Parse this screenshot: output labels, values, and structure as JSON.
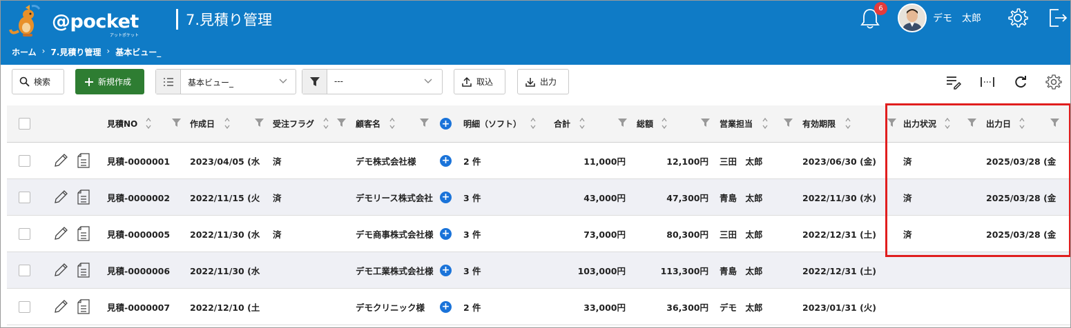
{
  "app": {
    "logo_text": "@pocket",
    "logo_sub": "アットポケット",
    "page_title": "7.見積り管理",
    "breadcrumb": [
      "ホーム",
      "7.見積り管理",
      "基本ビュー_"
    ],
    "notification_count": "6",
    "user_name": "デモ　太郎"
  },
  "toolbar": {
    "search_label": "検索",
    "new_label": "新規作成",
    "view_value": "基本ビュー_",
    "filter_value": "---",
    "import_label": "取込",
    "export_label": "出力"
  },
  "table": {
    "columns": [
      "見積NO",
      "作成日",
      "受注フラグ",
      "顧客名",
      "明細（ソフト）",
      "合計",
      "総額",
      "営業担当",
      "有効期限",
      "出力状況",
      "出力日"
    ],
    "rows": [
      {
        "no": "見積-0000001",
        "created": "2023/04/05 (水",
        "flag": "済",
        "customer": "デモ株式会社様",
        "detail": "2 件",
        "subtotal": "11,000円",
        "total": "12,100円",
        "sales": "三田　太郎",
        "expiry": "2023/06/30 (金)",
        "output_status": "済",
        "output_date": "2025/03/28 (金"
      },
      {
        "no": "見積-0000002",
        "created": "2022/11/15 (火",
        "flag": "済",
        "customer": "デモリース株式会社",
        "detail": "3 件",
        "subtotal": "43,000円",
        "total": "47,300円",
        "sales": "青島　太郎",
        "expiry": "2022/11/30 (水)",
        "output_status": "済",
        "output_date": "2025/03/28 (金"
      },
      {
        "no": "見積-0000005",
        "created": "2022/11/30 (水",
        "flag": "済",
        "customer": "デモ商事株式会社様",
        "detail": "3 件",
        "subtotal": "73,000円",
        "total": "80,300円",
        "sales": "三田　太郎",
        "expiry": "2022/12/31 (土)",
        "output_status": "済",
        "output_date": "2025/03/28 (金"
      },
      {
        "no": "見積-0000006",
        "created": "2022/11/30 (水",
        "flag": "",
        "customer": "デモ工業株式会社様",
        "detail": "3 件",
        "subtotal": "103,000円",
        "total": "113,300円",
        "sales": "青島　太郎",
        "expiry": "2022/12/31 (土)",
        "output_status": "",
        "output_date": ""
      },
      {
        "no": "見積-0000007",
        "created": "2022/12/10 (土",
        "flag": "",
        "customer": "デモクリニック様",
        "detail": "2 件",
        "subtotal": "33,000円",
        "total": "36,300円",
        "sales": "デモ　太郎",
        "expiry": "2023/01/31 (火)",
        "output_status": "",
        "output_date": ""
      }
    ]
  },
  "colors": {
    "header_bg": "#0f7bc6",
    "new_button": "#2e7d32",
    "highlight": "#e01e1e",
    "plus_icon": "#1a73d9"
  }
}
